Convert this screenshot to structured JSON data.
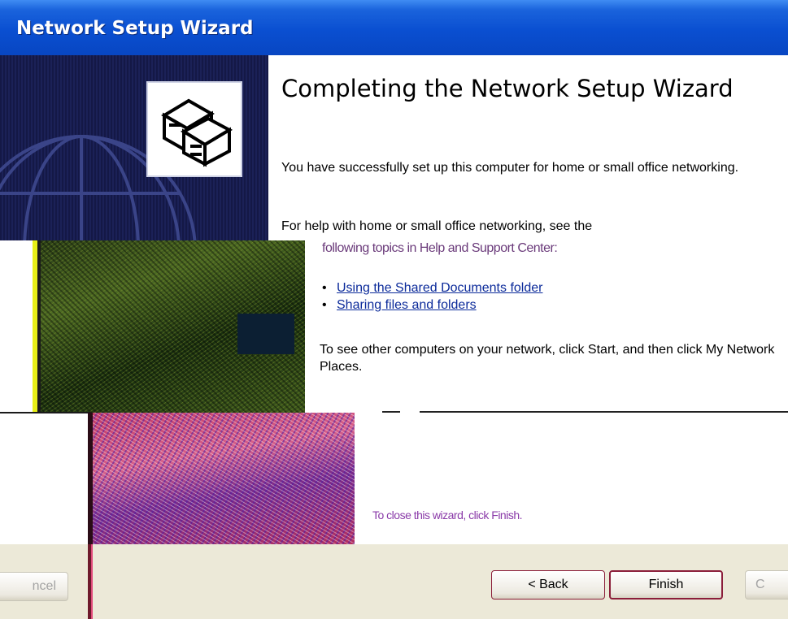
{
  "window": {
    "title": "Network Setup Wizard"
  },
  "heading": "Completing the Network Setup Wizard",
  "paragraphs": {
    "success": "You have successfully set up this computer for home or small office networking.",
    "help_intro": "For help with home or small office networking, see the",
    "help_intro_cont": "following topics in Help and Support Center:",
    "see_computers": "To see other computers on your network, click Start, and then click My Network Places.",
    "close_hint": "To close this wizard, click Finish."
  },
  "links": [
    {
      "label": "Using the Shared Documents folder"
    },
    {
      "label": "Sharing files and folders"
    }
  ],
  "buttons": {
    "cancel_left": "ncel",
    "back": "< Back",
    "finish": "Finish",
    "cancel_right": "C"
  },
  "colors": {
    "titlebar": "#0a4fd1",
    "banner": "#1b2157",
    "link": "#0b2a9a",
    "dialog_bg": "#ece9d8"
  },
  "icons": {
    "wizard": "network-computers-icon",
    "banner_art": "globe-icon"
  }
}
